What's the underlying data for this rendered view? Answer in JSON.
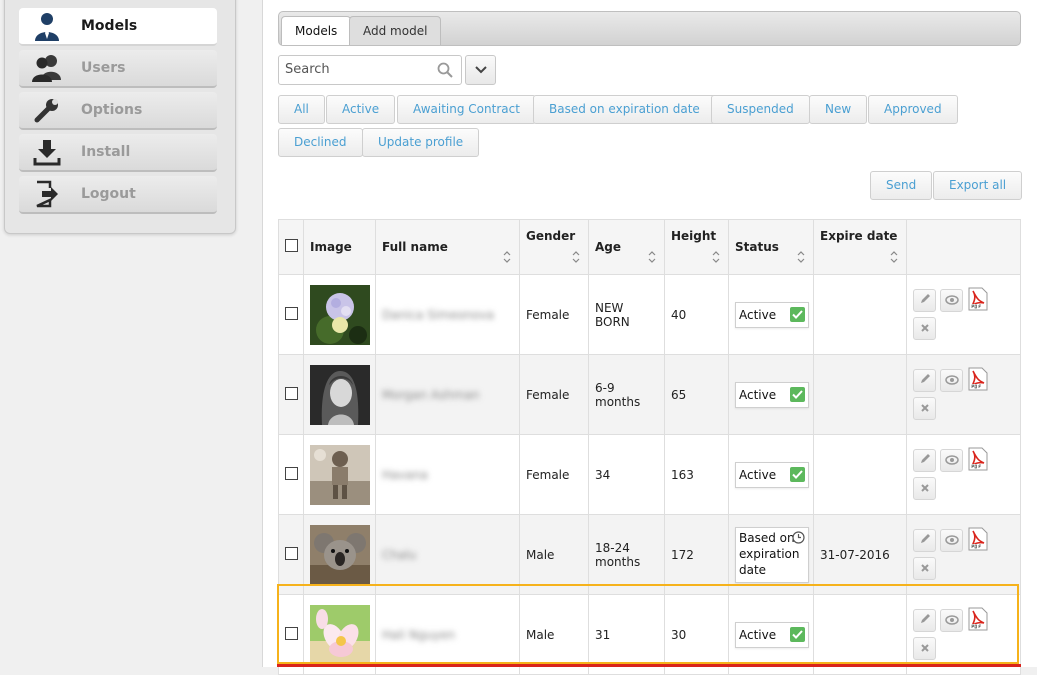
{
  "sidebar": {
    "items": [
      {
        "label": "Models",
        "icon": "user-icon",
        "active": true
      },
      {
        "label": "Users",
        "icon": "users-icon",
        "active": false
      },
      {
        "label": "Options",
        "icon": "wrench-icon",
        "active": false
      },
      {
        "label": "Install",
        "icon": "download-icon",
        "active": false
      },
      {
        "label": "Logout",
        "icon": "logout-icon",
        "active": false
      }
    ]
  },
  "tabs": [
    {
      "label": "Models",
      "active": true
    },
    {
      "label": "Add model",
      "active": false
    }
  ],
  "search": {
    "placeholder": "Search",
    "value": ""
  },
  "filters": [
    "All",
    "Active",
    "Awaiting Contract",
    "Based on expiration date",
    "Suspended",
    "New",
    "Approved",
    "Declined",
    "Update profile"
  ],
  "toolbar": {
    "send_label": "Send",
    "export_label": "Export all"
  },
  "table": {
    "headers": [
      "Image",
      "Full name",
      "Gender",
      "Age",
      "Height",
      "Status",
      "Expire date"
    ],
    "rows": [
      {
        "image": "flower-hydrangea",
        "name": "Danica Simeonova",
        "gender": "Female",
        "age": "NEW BORN",
        "height": "40",
        "status": "Active",
        "expire": ""
      },
      {
        "image": "portrait-girl",
        "name": "Morgan Ashman",
        "gender": "Female",
        "age": "6-9 months",
        "height": "65",
        "status": "Active",
        "expire": ""
      },
      {
        "image": "vintage-child",
        "name": "Havana",
        "gender": "Female",
        "age": "34",
        "height": "163",
        "status": "Active",
        "expire": ""
      },
      {
        "image": "koala",
        "name": "Chalu",
        "gender": "Male",
        "age": "18-24 months",
        "height": "172",
        "status": "Based on expiration date",
        "expire": "31-07-2016"
      },
      {
        "image": "frangipani-flower",
        "name": "Hali Nguyen",
        "gender": "Male",
        "age": "31",
        "height": "30",
        "status": "Active",
        "expire": ""
      }
    ]
  },
  "colors": {
    "accent": "#4a9fd2",
    "active_status": "#5cb85c",
    "highlight": "#f6b21b",
    "danger": "#d9241c"
  }
}
